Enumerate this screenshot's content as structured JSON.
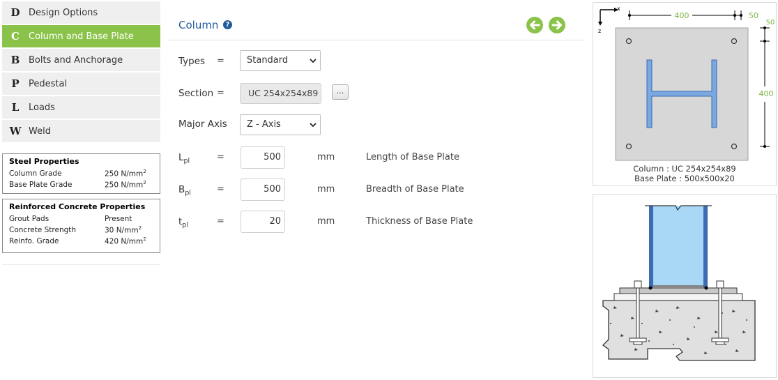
{
  "nav": [
    {
      "letter": "D",
      "label": "Design Options",
      "active": false
    },
    {
      "letter": "C",
      "label": "Column and Base Plate",
      "active": true
    },
    {
      "letter": "B",
      "label": "Bolts and Anchorage",
      "active": false
    },
    {
      "letter": "P",
      "label": "Pedestal",
      "active": false
    },
    {
      "letter": "L",
      "label": "Loads",
      "active": false
    },
    {
      "letter": "W",
      "label": "Weld",
      "active": false
    }
  ],
  "steel_properties": {
    "title": "Steel Properties",
    "rows": [
      {
        "key": "Column Grade",
        "value": "250 N/mm",
        "sup": "2"
      },
      {
        "key": "Base Plate Grade",
        "value": "250 N/mm",
        "sup": "2"
      }
    ]
  },
  "concrete_properties": {
    "title": "Reinforced Concrete Properties",
    "rows": [
      {
        "key": "Grout Pads",
        "value": "Present",
        "sup": ""
      },
      {
        "key": "Concrete Strength",
        "value": "30 N/mm",
        "sup": "2"
      },
      {
        "key": "Reinfo. Grade",
        "value": "420 N/mm",
        "sup": "2"
      }
    ]
  },
  "header": {
    "title": "Column",
    "help_icon": "?"
  },
  "colors": {
    "accent_green": "#8bc34a",
    "title_blue": "#1f5a9c",
    "profile_blue": "#6f9fd8",
    "column_fill": "#a8d8f5"
  },
  "form": {
    "types": {
      "label": "Types",
      "eq": "=",
      "value": "Standard"
    },
    "section": {
      "label": "Section",
      "eq": "=",
      "value": "UC 254x254x89",
      "button": "..."
    },
    "major_axis": {
      "label": "Major Axis",
      "value": "Z - Axis"
    },
    "lpl": {
      "label": "L",
      "sub": "pl",
      "eq": "=",
      "value": "500",
      "unit": "mm",
      "desc": "Length of Base Plate"
    },
    "bpl": {
      "label": "B",
      "sub": "pl",
      "eq": "=",
      "value": "500",
      "unit": "mm",
      "desc": "Breadth of Base Plate"
    },
    "tpl": {
      "label": "t",
      "sub": "pl",
      "eq": "=",
      "value": "20",
      "unit": "mm",
      "desc": "Thickness of Base Plate"
    }
  },
  "plan_view": {
    "axis_x": "x",
    "axis_z": "z",
    "dim_top": "400",
    "dim_top_right": "50",
    "dim_right_top": "50",
    "dim_right": "400",
    "caption_line1": "Column : UC 254x254x89",
    "caption_line2": "Base Plate : 500x500x20"
  }
}
